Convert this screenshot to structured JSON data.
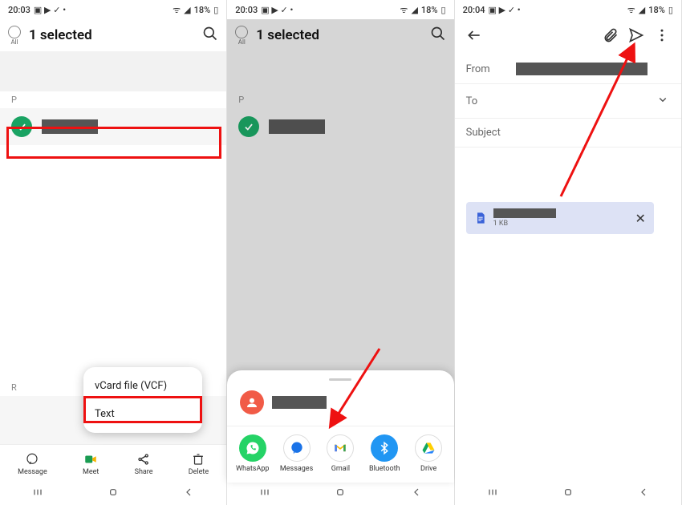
{
  "status": {
    "time_p1": "20:03",
    "time_p2": "20:03",
    "time_p3": "20:04",
    "battery": "18%"
  },
  "selection": {
    "count_label": "1 selected",
    "all_label": "All"
  },
  "sections": {
    "p": "P",
    "r": "R"
  },
  "popup": {
    "vcf": "vCard file (VCF)",
    "text": "Text"
  },
  "bnav": {
    "message": "Message",
    "meet": "Meet",
    "share": "Share",
    "delete": "Delete"
  },
  "share_apps": {
    "whatsapp": "WhatsApp",
    "messages": "Messages",
    "gmail": "Gmail",
    "bluetooth": "Bluetooth",
    "drive": "Drive"
  },
  "compose": {
    "from": "From",
    "to": "To",
    "subject": "Subject",
    "att_size": "1 KB"
  }
}
